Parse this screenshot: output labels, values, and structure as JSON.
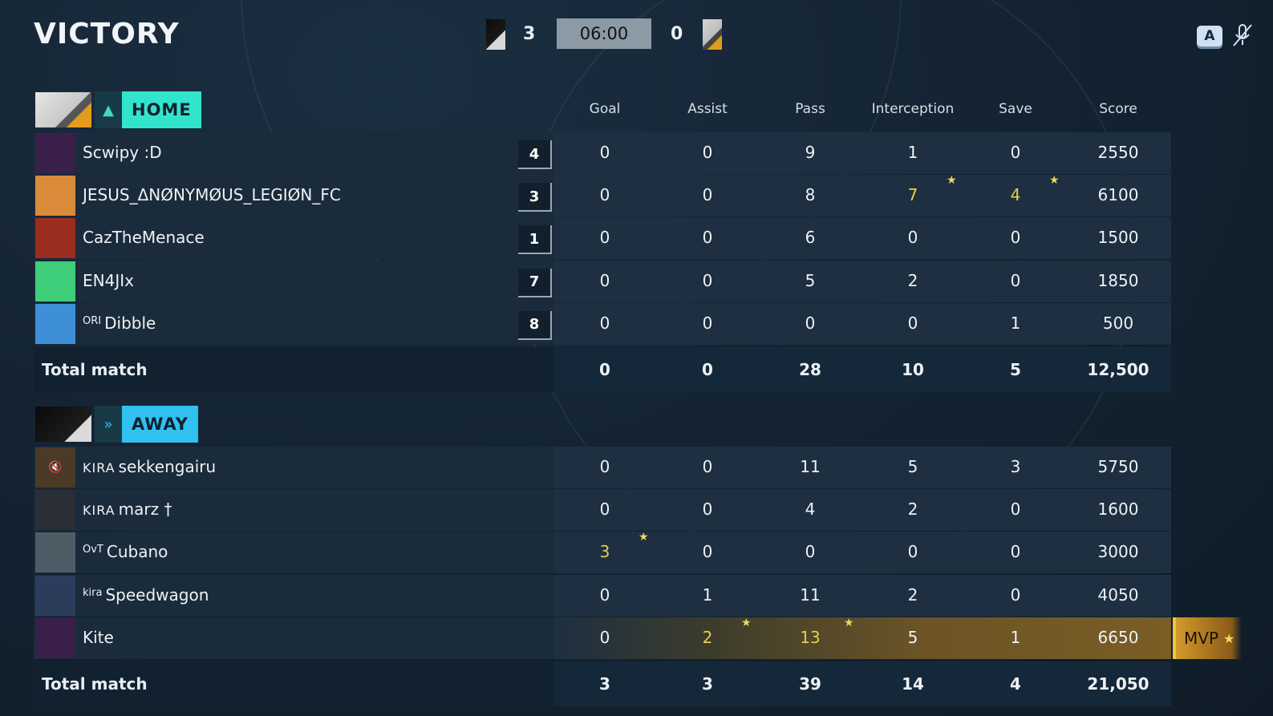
{
  "header": {
    "title": "VICTORY",
    "home_score": "3",
    "timer": "06:00",
    "away_score": "0",
    "a_badge": "A"
  },
  "columns": [
    "Goal",
    "Assist",
    "Pass",
    "Interception",
    "Save",
    "Score"
  ],
  "home": {
    "label": "HOME",
    "players": [
      {
        "tag": "",
        "name": "Scwipy :D",
        "jersey": "4",
        "stats": [
          "0",
          "0",
          "9",
          "1",
          "0",
          "2550"
        ],
        "avatar_color": "#3a1f4a"
      },
      {
        "tag": "",
        "name": "JESUS_ΔNØNYMØUS_LEGIØN_FC",
        "jersey": "3",
        "stats": [
          "0",
          "0",
          "8",
          "7",
          "4",
          "6100"
        ],
        "avatar_color": "#d98b3a"
      },
      {
        "tag": "",
        "name": "CazTheMenace",
        "jersey": "1",
        "stats": [
          "0",
          "0",
          "6",
          "0",
          "0",
          "1500"
        ],
        "avatar_color": "#9b2d1f"
      },
      {
        "tag": "",
        "name": "EN4JIx",
        "jersey": "7",
        "stats": [
          "0",
          "0",
          "5",
          "2",
          "0",
          "1850"
        ],
        "avatar_color": "#3fcf7a"
      },
      {
        "tag": "ORI",
        "name": "Dibble",
        "jersey": "8",
        "stats": [
          "0",
          "0",
          "0",
          "0",
          "1",
          "500"
        ],
        "avatar_color": "#3e8fd6"
      }
    ],
    "total_label": "Total match",
    "totals": [
      "0",
      "0",
      "28",
      "10",
      "5",
      "12,500"
    ]
  },
  "away": {
    "label": "AWAY",
    "players": [
      {
        "tag": "KIRA",
        "name": "sekkengairu",
        "stats": [
          "0",
          "0",
          "11",
          "5",
          "3",
          "5750"
        ],
        "avatar_color": "#4a3a26"
      },
      {
        "tag": "KIRA",
        "name": "marz †",
        "stats": [
          "0",
          "0",
          "4",
          "2",
          "0",
          "1600"
        ],
        "avatar_color": "#2a2f36"
      },
      {
        "tag": "OvT",
        "name": "Cubano",
        "stats": [
          "3",
          "0",
          "0",
          "0",
          "0",
          "3000"
        ],
        "avatar_color": "#4c5d66"
      },
      {
        "tag": "kira",
        "name": "Speedwagon",
        "stats": [
          "0",
          "1",
          "11",
          "2",
          "0",
          "4050"
        ],
        "avatar_color": "#2c3d5c"
      },
      {
        "tag": "",
        "name": "Kite",
        "stats": [
          "0",
          "2",
          "13",
          "5",
          "1",
          "6650"
        ],
        "avatar_color": "#3a1f4a"
      }
    ],
    "total_label": "Total match",
    "totals": [
      "3",
      "3",
      "39",
      "14",
      "4",
      "21,050"
    ]
  },
  "mvp_label": "MVP",
  "colors": {
    "gold": "#e6cf4c",
    "home_accent": "#33e4cc",
    "away_accent": "#30c1f0",
    "highlight": "#e1c936"
  }
}
